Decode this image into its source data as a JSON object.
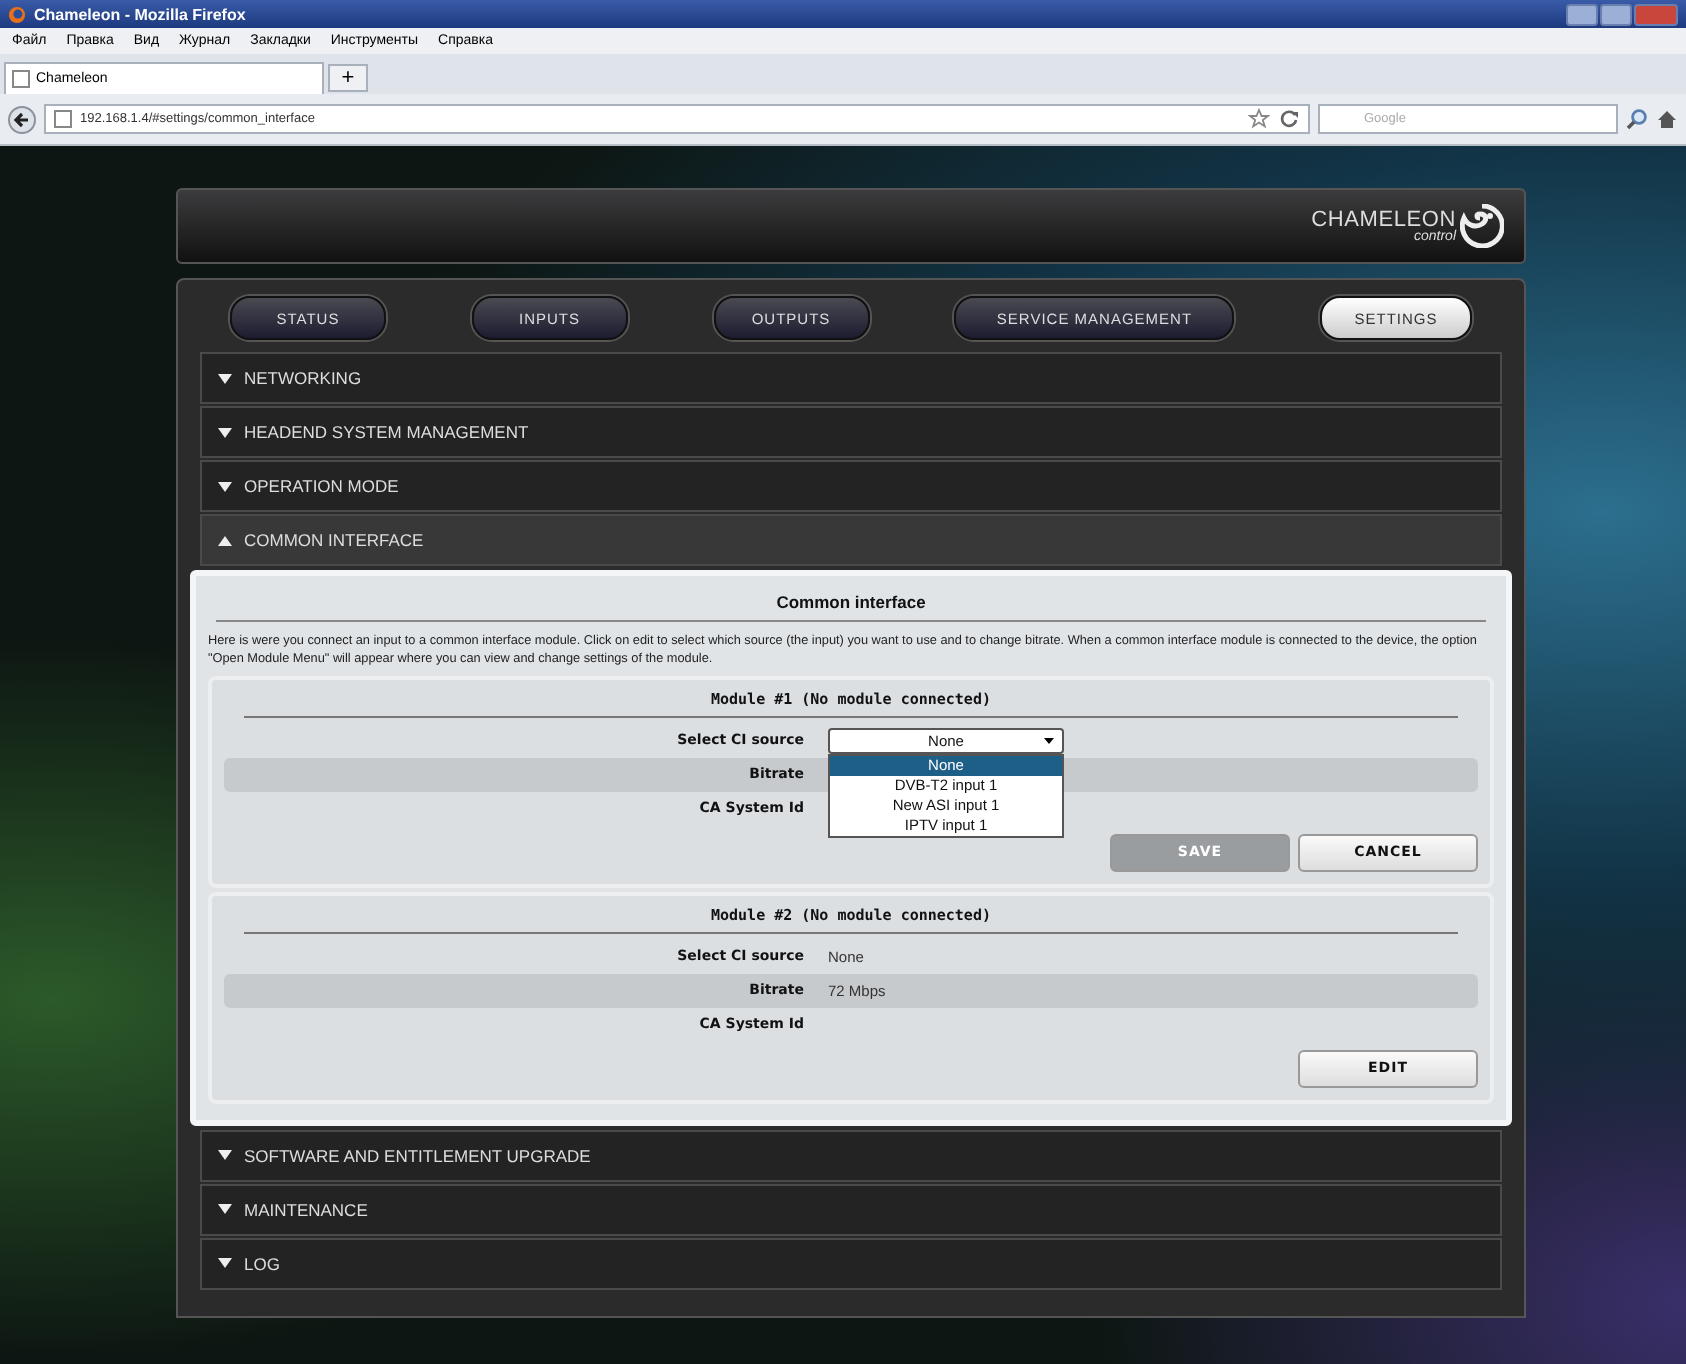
{
  "browser": {
    "title": "Chameleon - Mozilla Firefox",
    "menu": [
      "Файл",
      "Правка",
      "Вид",
      "Журнал",
      "Закладки",
      "Инструменты",
      "Справка"
    ],
    "tabs": [
      {
        "label": "Chameleon",
        "selected": true
      }
    ],
    "new_tab": "+",
    "address": "192.168.1.4/#settings/common_interface",
    "search": {
      "placeholder": "Google"
    }
  },
  "logo": {
    "name": "CHAMELEON",
    "tagline": "control"
  },
  "nav": [
    {
      "label": "STATUS",
      "selected": false
    },
    {
      "label": "INPUTS",
      "selected": false
    },
    {
      "label": "OUTPUTS",
      "selected": false
    },
    {
      "label": "SERVICE MANAGEMENT",
      "selected": false
    },
    {
      "label": "SETTINGS",
      "selected": true
    }
  ],
  "sections": [
    {
      "title": "NETWORKING",
      "expanded": false
    },
    {
      "title": "HEADEND SYSTEM MANAGEMENT",
      "expanded": false
    },
    {
      "title": "OPERATION MODE",
      "expanded": false
    },
    {
      "title": "COMMON INTERFACE",
      "expanded": true,
      "panel": {
        "heading": "Common interface",
        "description": "Here is were you connect an input to a common interface module. Click on edit to select which source (the input) you want to use and to change bitrate. When a common interface module is connected to the device, the option \"Open Module Menu\" will appear where you can view and change settings of the module.",
        "modules": [
          {
            "heading": "Module #1 (No module connected)",
            "fields": [
              {
                "kind": "dropdown",
                "label": "Select CI source",
                "value": "None",
                "open": true,
                "options": [
                  {
                    "label": "None",
                    "selected": true
                  },
                  {
                    "label": "DVB-T2 input 1",
                    "selected": false
                  },
                  {
                    "label": "New ASI input 1",
                    "selected": false
                  },
                  {
                    "label": "IPTV input 1",
                    "selected": false
                  }
                ]
              },
              {
                "kind": "text",
                "label": "Bitrate"
              },
              {
                "kind": "text",
                "label": "CA System Id"
              }
            ],
            "buttons": [
              {
                "label": "SAVE",
                "disabled": true
              },
              {
                "label": "CANCEL",
                "disabled": false
              }
            ]
          },
          {
            "heading": "Module #2 (No module connected)",
            "fields": [
              {
                "kind": "text",
                "label": "Select CI source",
                "value": "None"
              },
              {
                "kind": "text",
                "label": "Bitrate",
                "value": "72 Mbps"
              },
              {
                "kind": "text",
                "label": "CA System Id"
              }
            ],
            "buttons": [
              {
                "label": "EDIT",
                "disabled": false
              }
            ]
          }
        ]
      }
    },
    {
      "title": "SOFTWARE AND ENTITLEMENT UPGRADE",
      "expanded": false
    },
    {
      "title": "MAINTENANCE",
      "expanded": false
    },
    {
      "title": "LOG",
      "expanded": false
    }
  ]
}
